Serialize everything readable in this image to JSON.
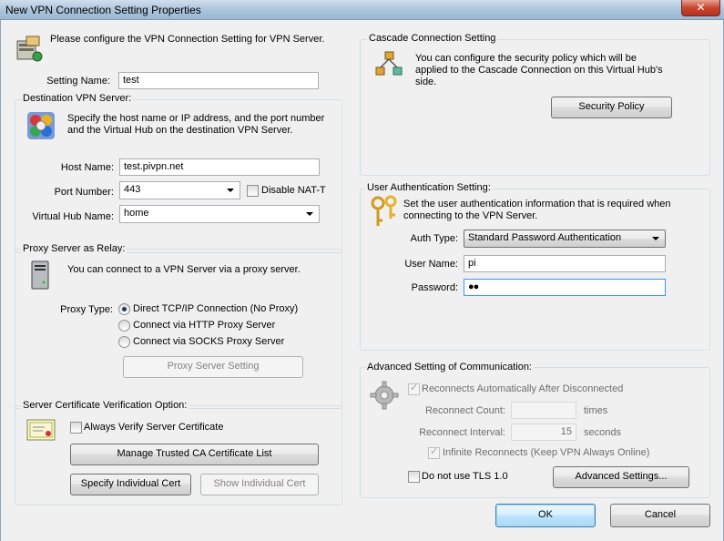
{
  "window": {
    "title": "New VPN Connection Setting Properties",
    "close_glyph": "✕"
  },
  "intro": "Please configure the VPN Connection Setting for VPN Server.",
  "setting_name": {
    "label": "Setting Name:",
    "value": "test"
  },
  "destination": {
    "group_title": "Destination VPN Server:",
    "description_line1": "Specify the host name or IP address, and the port number",
    "description_line2": "and the Virtual Hub on the destination VPN Server.",
    "host_label": "Host Name:",
    "host_value": "test.pivpn.net",
    "port_label": "Port Number:",
    "port_value": "443",
    "disable_nat_label": "Disable NAT-T",
    "hub_label": "Virtual Hub Name:",
    "hub_value": "home"
  },
  "proxy": {
    "group_title": "Proxy Server as Relay:",
    "description": "You can connect to a VPN Server via a proxy server.",
    "type_label": "Proxy Type:",
    "options": [
      "Direct TCP/IP Connection (No Proxy)",
      "Connect via HTTP Proxy Server",
      "Connect via SOCKS Proxy Server"
    ],
    "selected_index": 0,
    "setting_button": "Proxy Server Setting"
  },
  "cert": {
    "group_title": "Server Certificate Verification Option:",
    "always_verify_label": "Always Verify Server Certificate",
    "manage_button": "Manage Trusted CA Certificate List",
    "specify_button": "Specify Individual Cert",
    "show_button": "Show Individual Cert"
  },
  "cascade": {
    "group_title": "Cascade Connection Setting",
    "description_line1": "You can configure the security policy which will be",
    "description_line2": "applied to the Cascade Connection on this Virtual Hub's",
    "description_line3": "side.",
    "policy_button": "Security Policy"
  },
  "auth": {
    "group_title": "User Authentication Setting:",
    "description_line1": "Set the user authentication information that is required when",
    "description_line2": "connecting to the VPN Server.",
    "type_label": "Auth Type:",
    "type_value": "Standard Password Authentication",
    "user_label": "User Name:",
    "user_value": "pi",
    "password_label": "Password:",
    "password_value": "●●"
  },
  "advanced": {
    "group_title": "Advanced Setting of Communication:",
    "reconnect_label": "Reconnects Automatically After Disconnected",
    "reconnect_count_label": "Reconnect Count:",
    "reconnect_count_value": "",
    "times_label": "times",
    "reconnect_interval_label": "Reconnect Interval:",
    "reconnect_interval_value": "15",
    "seconds_label": "seconds",
    "infinite_label": "Infinite Reconnects (Keep VPN Always Online)",
    "no_tls_label": "Do not use TLS 1.0",
    "advanced_button": "Advanced Settings..."
  },
  "footer": {
    "ok": "OK",
    "cancel": "Cancel"
  }
}
